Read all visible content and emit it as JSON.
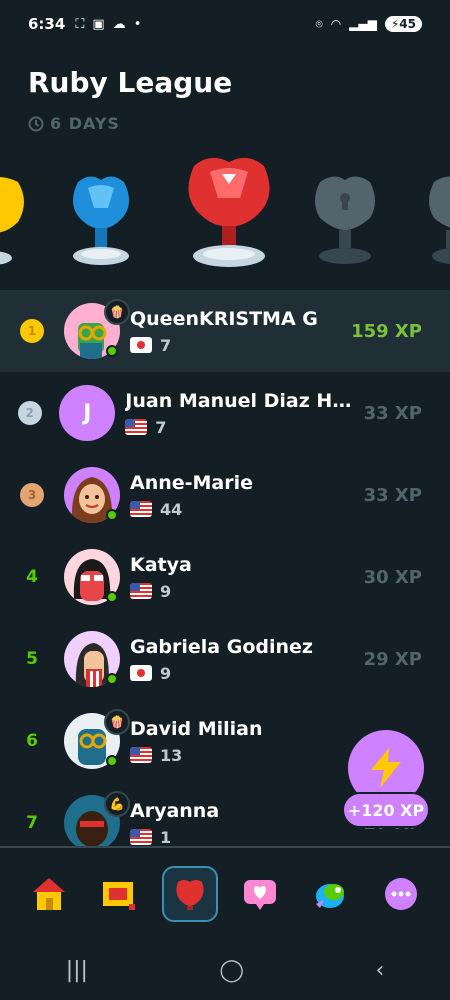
{
  "status_bar": {
    "time": "6:34",
    "battery": "45"
  },
  "league": {
    "title": "Ruby League",
    "days": "6 DAYS"
  },
  "leaderboard": [
    {
      "rank": "1",
      "name": "QueenKRISTMA G",
      "country": "JP",
      "streak": "7",
      "xp": "159 XP",
      "is_me": true
    },
    {
      "rank": "2",
      "name": "Juan Manuel Diaz He...",
      "country": "US",
      "streak": "7",
      "xp": "33 XP",
      "avatar_letter": "J"
    },
    {
      "rank": "3",
      "name": "Anne-Marie",
      "country": "US",
      "streak": "44",
      "xp": "33 XP"
    },
    {
      "rank": "4",
      "name": "Katya",
      "country": "US",
      "streak": "9",
      "xp": "30 XP"
    },
    {
      "rank": "5",
      "name": "Gabriela Godinez",
      "country": "JP",
      "streak": "9",
      "xp": "29 XP"
    },
    {
      "rank": "6",
      "name": "David Milian",
      "country": "US",
      "streak": "13",
      "xp": ""
    },
    {
      "rank": "7",
      "name": "Aryanna",
      "country": "US",
      "streak": "1",
      "xp": "27 XP"
    }
  ],
  "bonus": {
    "label": "+120 XP"
  },
  "tabs": [
    "home-tab",
    "quests-tab",
    "leaderboard-tab",
    "social-tab",
    "characters-tab",
    "more-tab"
  ],
  "colors": {
    "accent_green": "#58cc02",
    "xp_green": "#79c23a",
    "ruby": "#e03131",
    "purple": "#ce82ff",
    "background": "#131f24"
  }
}
